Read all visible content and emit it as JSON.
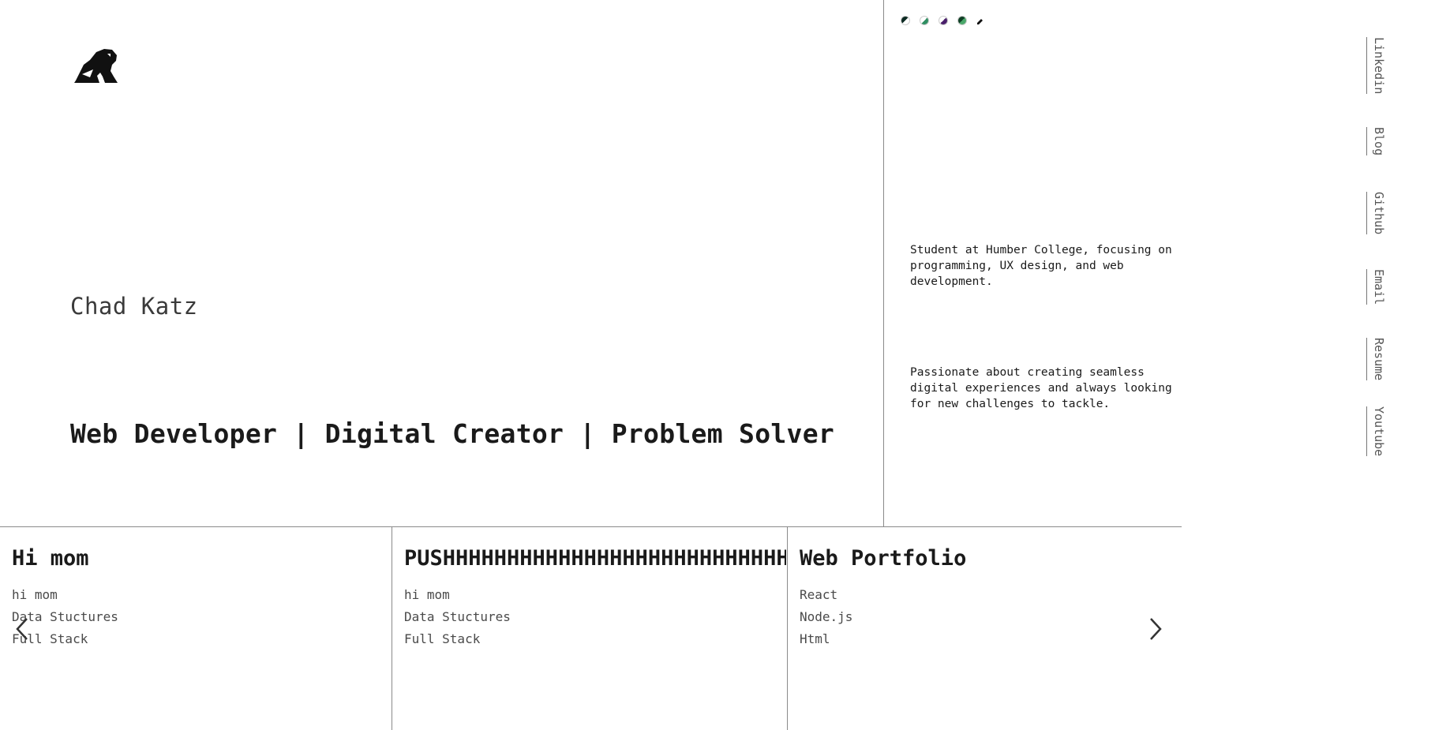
{
  "header": {
    "logo_icon": "frog-logo-icon"
  },
  "hero": {
    "name": "Chad Katz",
    "tagline": "Web Developer | Digital Creator | Problem Solver"
  },
  "theme_switcher": {
    "swatches": [
      {
        "icon": "theme-swatch-icon",
        "primary": "#0c2a22",
        "secondary": "#ffffff"
      },
      {
        "icon": "theme-swatch-icon",
        "primary": "#2f8f62",
        "secondary": "#ffffff"
      },
      {
        "icon": "theme-swatch-icon",
        "primary": "#4a1f6b",
        "secondary": "#ffffff"
      },
      {
        "icon": "theme-swatch-icon",
        "primary": "#0f3f25",
        "secondary": "#4aa86a"
      }
    ],
    "pen_icon": "pen-icon"
  },
  "about": {
    "paragraph_1": "Student at Humber College, focusing on programming, UX design, and web development.",
    "paragraph_2": "Passionate about creating seamless digital experiences and always looking for new challenges to tackle."
  },
  "social": {
    "links": [
      {
        "label": "Linkedin"
      },
      {
        "label": "Blog"
      },
      {
        "label": "Github"
      },
      {
        "label": "Email"
      },
      {
        "label": "Resume"
      },
      {
        "label": "Youtube"
      }
    ]
  },
  "projects": {
    "cards": [
      {
        "title": "Hi mom",
        "tags": [
          "hi mom",
          "Data Stuctures",
          "Full Stack"
        ]
      },
      {
        "title": "PUSHHHHHHHHHHHHHHHHHHHHHHHHHHHHHHHHH",
        "tags": [
          "hi mom",
          "Data Stuctures",
          "Full Stack"
        ]
      },
      {
        "title": "Web Portfolio",
        "tags": [
          "React",
          "Node.js",
          "Html"
        ]
      }
    ],
    "prev_icon": "chevron-left-icon",
    "next_icon": "chevron-right-icon"
  },
  "colors": {
    "text": "#1a1a1a",
    "muted_text": "#555555",
    "divider": "#8a8a8a",
    "background": "#ffffff"
  }
}
